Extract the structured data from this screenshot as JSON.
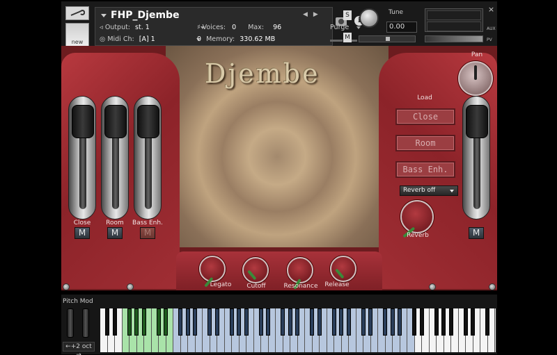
{
  "header": {
    "instrument_name": "FHP_Djembe",
    "new_label": "new",
    "output_label": "Output:",
    "output_value": "st. 1",
    "voices_label": "Voices:",
    "voices_value": "0",
    "max_label": "Max:",
    "max_value": "96",
    "midi_label": "Midi Ch:",
    "midi_value": "[A]  1",
    "memory_label": "Memory:",
    "memory_value": "330.62 MB",
    "purge_label": "Purge",
    "s_label": "S",
    "m_label": "M",
    "tune_label": "Tune",
    "tune_value": "0.00",
    "close_label": "×",
    "aux_label": "AUX",
    "pv_label": "PV",
    "memory_meter_label": "0"
  },
  "instrument": {
    "title": "Djembe",
    "channels": [
      {
        "label": "Close",
        "mute": "M",
        "muted": false
      },
      {
        "label": "Room",
        "mute": "M",
        "muted": false
      },
      {
        "label": "Bass Enh.",
        "mute": "M",
        "muted": true
      }
    ],
    "right": {
      "pan_label": "Pan",
      "load_label": "Load",
      "load_buttons": [
        "Close",
        "Room",
        "Bass Enh."
      ],
      "reverb_dropdown": "Reverb off",
      "reverb_label": "Reverb",
      "master_mute": "M"
    },
    "bottom_knobs": [
      "Legato",
      "Cutoff",
      "Resonance",
      "Release"
    ]
  },
  "keyboard": {
    "pitch_mod_label": "Pitch Mod",
    "octave_label": "←+2 oct →"
  },
  "colors": {
    "panel_red": "#8c2329",
    "keyswitch_green": "#a9e3a9",
    "range_blue": "#b7c7de"
  }
}
